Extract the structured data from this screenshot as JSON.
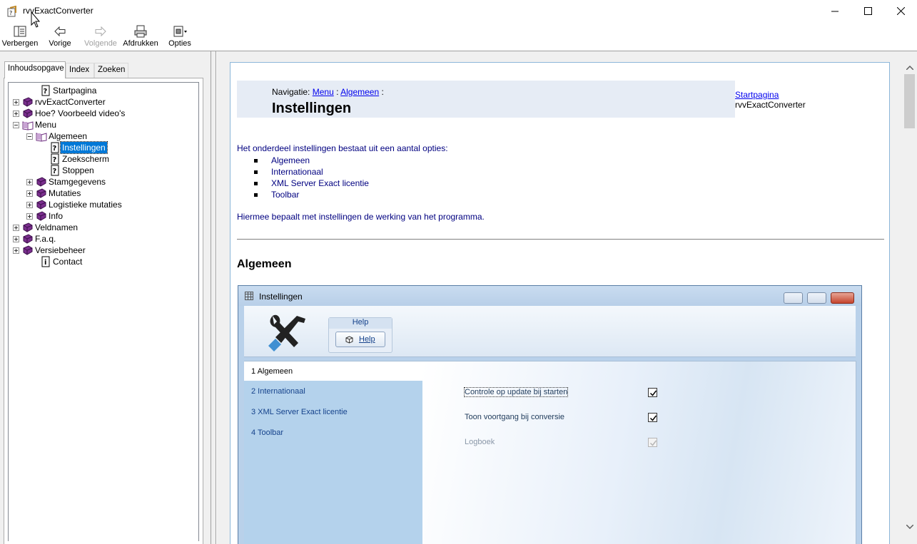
{
  "window": {
    "title": "rvvExactConverter",
    "minimize_icon": "minimize-icon",
    "maximize_icon": "maximize-icon",
    "close_icon": "close-icon"
  },
  "toolbar": {
    "hide_label": "Verbergen",
    "back_label": "Vorige",
    "forward_label": "Volgende",
    "print_label": "Afdrukken",
    "options_label": "Opties"
  },
  "tabs": {
    "contents": "Inhoudsopgave",
    "index": "Index",
    "search": "Zoeken"
  },
  "tree": [
    {
      "label": "Startpagina",
      "icon": "help-page-icon",
      "expander": "none"
    },
    {
      "label": "rvvExactConverter",
      "icon": "book-icon",
      "expander": "plus"
    },
    {
      "label": "Hoe? Voorbeeld video's",
      "icon": "book-icon",
      "expander": "plus"
    },
    {
      "label": "Menu",
      "icon": "open-book-icon",
      "expander": "minus"
    },
    {
      "label": "Algemeen",
      "icon": "open-book-icon",
      "expander": "minus"
    },
    {
      "label": "Instellingen",
      "icon": "help-page-icon",
      "expander": "none",
      "selected": true
    },
    {
      "label": "Zoekscherm",
      "icon": "help-page-icon",
      "expander": "none"
    },
    {
      "label": "Stoppen",
      "icon": "help-page-icon",
      "expander": "none"
    },
    {
      "label": "Stamgegevens",
      "icon": "book-icon",
      "expander": "plus"
    },
    {
      "label": "Mutaties",
      "icon": "book-icon",
      "expander": "plus"
    },
    {
      "label": "Logistieke mutaties",
      "icon": "book-icon",
      "expander": "plus"
    },
    {
      "label": "Info",
      "icon": "book-icon",
      "expander": "plus"
    },
    {
      "label": "Veldnamen",
      "icon": "book-icon",
      "expander": "plus"
    },
    {
      "label": "F.a.q.",
      "icon": "book-icon",
      "expander": "plus"
    },
    {
      "label": "Versiebeheer",
      "icon": "book-icon",
      "expander": "plus"
    },
    {
      "label": "Contact",
      "icon": "info-page-icon",
      "expander": "none"
    }
  ],
  "page": {
    "nav_prefix": "Navigatie:",
    "nav_link1": "Menu",
    "nav_sep1": ":",
    "nav_link2": "Algemeen",
    "nav_sep2": ":",
    "title": "Instellingen",
    "home_link": "Startpagina",
    "product": "rvvExactConverter",
    "intro": "Het onderdeel instellingen bestaat uit een aantal opties:",
    "options": [
      "Algemeen",
      "Internationaal",
      "XML Server Exact licentie",
      "Toolbar"
    ],
    "outro": "Hiermee bepaalt met instellingen de werking van het programma.",
    "section_heading": "Algemeen"
  },
  "screenshot": {
    "window_title": "Instellingen",
    "help_group": "Help",
    "help_button": "Help",
    "nav_items": [
      "1 Algemeen",
      "2 Internationaal",
      "3 XML Server Exact licentie",
      "4 Toolbar"
    ],
    "checkboxes": [
      {
        "label": "Controle op update bij starten",
        "checked": true,
        "enabled": true
      },
      {
        "label": "Toon voortgang bij conversie",
        "checked": true,
        "enabled": true
      },
      {
        "label": "Logboek",
        "checked": true,
        "enabled": false
      }
    ]
  },
  "colors": {
    "link": "#0000ee",
    "body_text": "#000080",
    "selection": "#0078d7",
    "nav_band": "#e6ecf5"
  }
}
